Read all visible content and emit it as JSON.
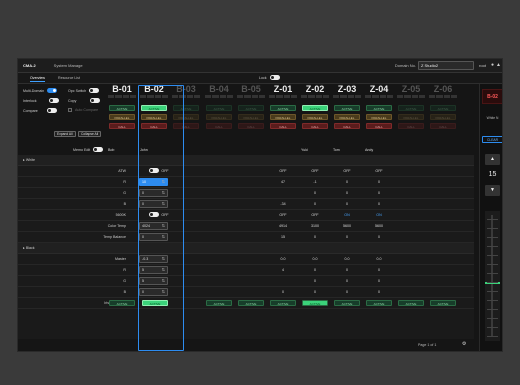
{
  "app": {
    "logo": "CMA-2",
    "menu": "System Manage"
  },
  "domain": {
    "label": "Domain No.",
    "value": "Z Studio2"
  },
  "user": {
    "name": "root"
  },
  "tabs": [
    {
      "label": "Overview"
    },
    {
      "label": "Resource List"
    }
  ],
  "lock": {
    "label": "Lock",
    "on": false
  },
  "controls": {
    "multi_domain": "Multi-Domain",
    "opc_switch": "Opc Switch",
    "interlock": "Interlock",
    "copy": "Copy",
    "compare": "Compare",
    "auto_compare": "Auto Compare",
    "expand_all": "Expand All",
    "collapse_all": "Collapse All",
    "memo_edit": "Memo Edit"
  },
  "channels": [
    {
      "name": "B-01",
      "active": "ACTIVE",
      "parallel": "PARALLEL",
      "call": "CALL",
      "memo": "Bob",
      "lit": false,
      "dim": false
    },
    {
      "name": "B-02",
      "active": "ACTIVE",
      "parallel": "PARALLEL",
      "call": "CALL",
      "memo": "John",
      "lit": true,
      "dim": false
    },
    {
      "name": "B-03",
      "active": "ACTIVE",
      "parallel": "PARALLEL",
      "call": "CALL",
      "memo": "",
      "lit": false,
      "dim": true
    },
    {
      "name": "B-04",
      "active": "ACTIVE",
      "parallel": "PARALLEL",
      "call": "CALL",
      "memo": "",
      "lit": false,
      "dim": true
    },
    {
      "name": "B-05",
      "active": "ACTIVE",
      "parallel": "PARALLEL",
      "call": "CALL",
      "memo": "",
      "lit": false,
      "dim": true
    },
    {
      "name": "Z-01",
      "active": "ACTIVE",
      "parallel": "PARALLEL",
      "call": "CALL",
      "memo": "",
      "lit": false,
      "dim": false
    },
    {
      "name": "Z-02",
      "active": "ACTIVE",
      "parallel": "PARALLEL",
      "call": "CALL",
      "memo": "Yuki",
      "lit": true,
      "dim": false
    },
    {
      "name": "Z-03",
      "active": "ACTIVE",
      "parallel": "PARALLEL",
      "call": "CALL",
      "memo": "Tom",
      "lit": false,
      "dim": false
    },
    {
      "name": "Z-04",
      "active": "ACTIVE",
      "parallel": "PARALLEL",
      "call": "CALL",
      "memo": "Andy",
      "lit": false,
      "dim": false
    },
    {
      "name": "Z-05",
      "active": "ACTIVE",
      "parallel": "PARALLEL",
      "call": "CALL",
      "memo": "",
      "lit": false,
      "dim": true
    },
    {
      "name": "Z-06",
      "active": "ACTIVE",
      "parallel": "PARALLEL",
      "call": "CALL",
      "memo": "",
      "lit": false,
      "dim": true
    }
  ],
  "sections": {
    "white": "White",
    "black": "Black"
  },
  "white_rows": [
    {
      "label": "ATW",
      "b02": "OFF",
      "vals": [
        "",
        "",
        "",
        "",
        "OFF",
        "OFF",
        "OFF",
        "OFF",
        "",
        ""
      ]
    },
    {
      "label": "R",
      "b02": "10",
      "vals": [
        "",
        "",
        "",
        "",
        "47",
        "-1",
        "0",
        "0",
        "",
        ""
      ]
    },
    {
      "label": "G",
      "b02": "0",
      "vals": [
        "",
        "",
        "",
        "",
        "",
        "0",
        "0",
        "0",
        "",
        ""
      ]
    },
    {
      "label": "B",
      "b02": "0",
      "vals": [
        "",
        "",
        "",
        "",
        "-34",
        "0",
        "0",
        "0",
        "",
        ""
      ]
    },
    {
      "label": "5600K",
      "b02": "OFF",
      "vals": [
        "",
        "",
        "",
        "",
        "OFF",
        "OFF",
        "ON",
        "ON",
        "",
        ""
      ]
    },
    {
      "label": "Color Temp",
      "b02": "4024",
      "vals": [
        "",
        "",
        "",
        "",
        "4914",
        "3100",
        "5600",
        "5600",
        "",
        ""
      ]
    },
    {
      "label": "Temp Balance",
      "b02": "0",
      "vals": [
        "",
        "",
        "",
        "",
        "15",
        "0",
        "0",
        "0",
        "",
        ""
      ]
    }
  ],
  "black_rows": [
    {
      "label": "Master",
      "b02": "-0.3",
      "vals": [
        "",
        "",
        "",
        "",
        "0.0",
        "0.0",
        "0.0",
        "0.0",
        "",
        ""
      ]
    },
    {
      "label": "R",
      "b02": "5",
      "vals": [
        "",
        "",
        "",
        "",
        "4",
        "0",
        "0",
        "0",
        "",
        ""
      ]
    },
    {
      "label": "G",
      "b02": "5",
      "vals": [
        "",
        "",
        "",
        "",
        "",
        "0",
        "0",
        "0",
        "",
        ""
      ]
    },
    {
      "label": "B",
      "b02": "0",
      "vals": [
        "",
        "",
        "",
        "",
        "0",
        "0",
        "0",
        "0",
        "",
        ""
      ]
    },
    {
      "label": "Iris/MB Active",
      "b02": "ACTIVE",
      "vals": [
        "ACTIVE",
        "",
        "ACTIVE",
        "ACTIVE",
        "ACTIVE",
        "ACTIVE",
        "ACTIVE",
        "ACTIVE",
        "ACTIVE",
        "ACTIVE"
      ]
    }
  ],
  "footer": {
    "page": "Page 1 of 1"
  },
  "right_panel": {
    "channel": "B-02",
    "white_n": "White N",
    "clear": "CLEAR",
    "value": "15",
    "up": "▲",
    "down": "▼"
  },
  "colors": {
    "accent": "#2d8cf0",
    "active": "#3bd27a",
    "call": "#5a1c1c",
    "parallel": "#4a3b1c"
  }
}
